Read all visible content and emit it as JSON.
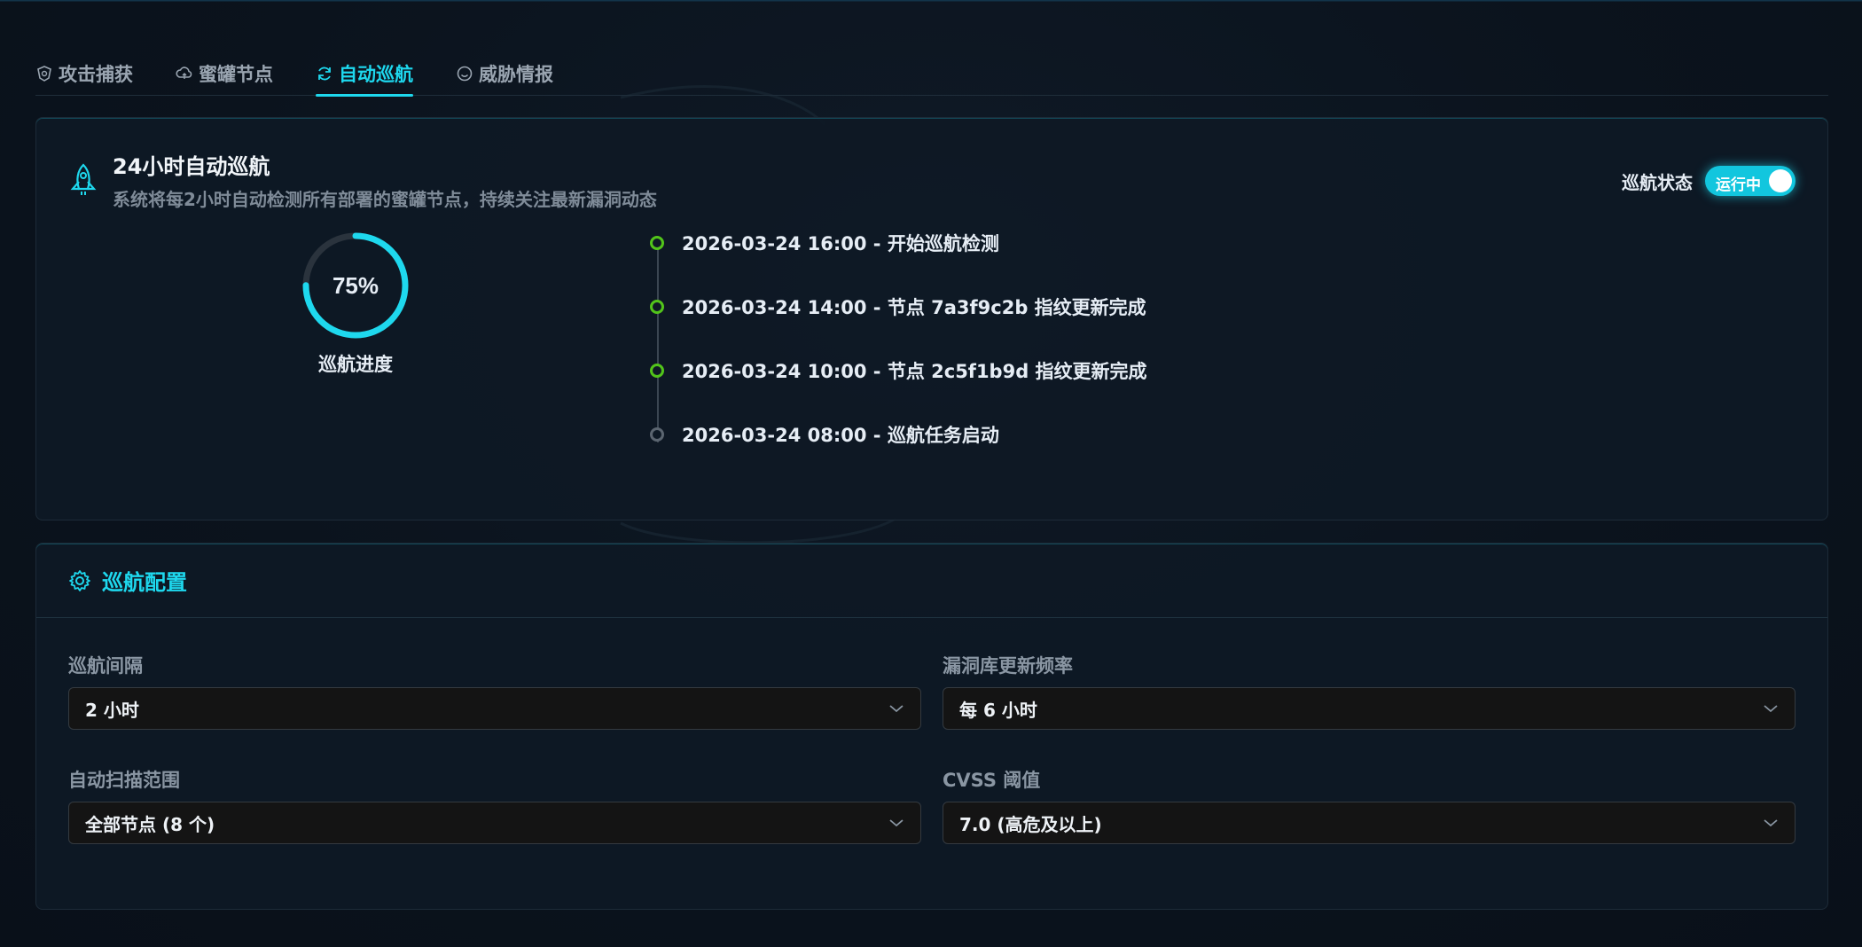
{
  "tabs": [
    {
      "label": "攻击捕获",
      "icon": "shield-icon"
    },
    {
      "label": "蜜罐节点",
      "icon": "cloud-icon"
    },
    {
      "label": "自动巡航",
      "icon": "refresh-icon",
      "active": true
    },
    {
      "label": "威胁情报",
      "icon": "smile-icon"
    }
  ],
  "cruise": {
    "title": "24小时自动巡航",
    "description": "系统将每2小时自动检测所有部署的蜜罐节点，持续关注最新漏洞动态",
    "status_label": "巡航状态",
    "toggle_text": "运行中",
    "toggle_on": true,
    "progress_percent": 75,
    "progress_text": "75%",
    "progress_label": "巡航进度",
    "timeline": [
      {
        "text": "2026-03-24 16:00 - 开始巡航检测",
        "status": "done"
      },
      {
        "text": "2026-03-24 14:00 - 节点 7a3f9c2b 指纹更新完成",
        "status": "done"
      },
      {
        "text": "2026-03-24 10:00 - 节点 2c5f1b9d 指纹更新完成",
        "status": "done"
      },
      {
        "text": "2026-03-24 08:00 - 巡航任务启动",
        "status": "pending"
      }
    ]
  },
  "config": {
    "title": "巡航配置",
    "fields": [
      {
        "label": "巡航间隔",
        "value": "2 小时"
      },
      {
        "label": "漏洞库更新频率",
        "value": "每 6 小时"
      },
      {
        "label": "自动扫描范围",
        "value": "全部节点 (8 个)"
      },
      {
        "label": "CVSS 阈值",
        "value": "7.0 (高危及以上)"
      }
    ]
  },
  "colors": {
    "accent": "#1ed8ee",
    "success": "#52c41a",
    "background": "#0a111b"
  }
}
